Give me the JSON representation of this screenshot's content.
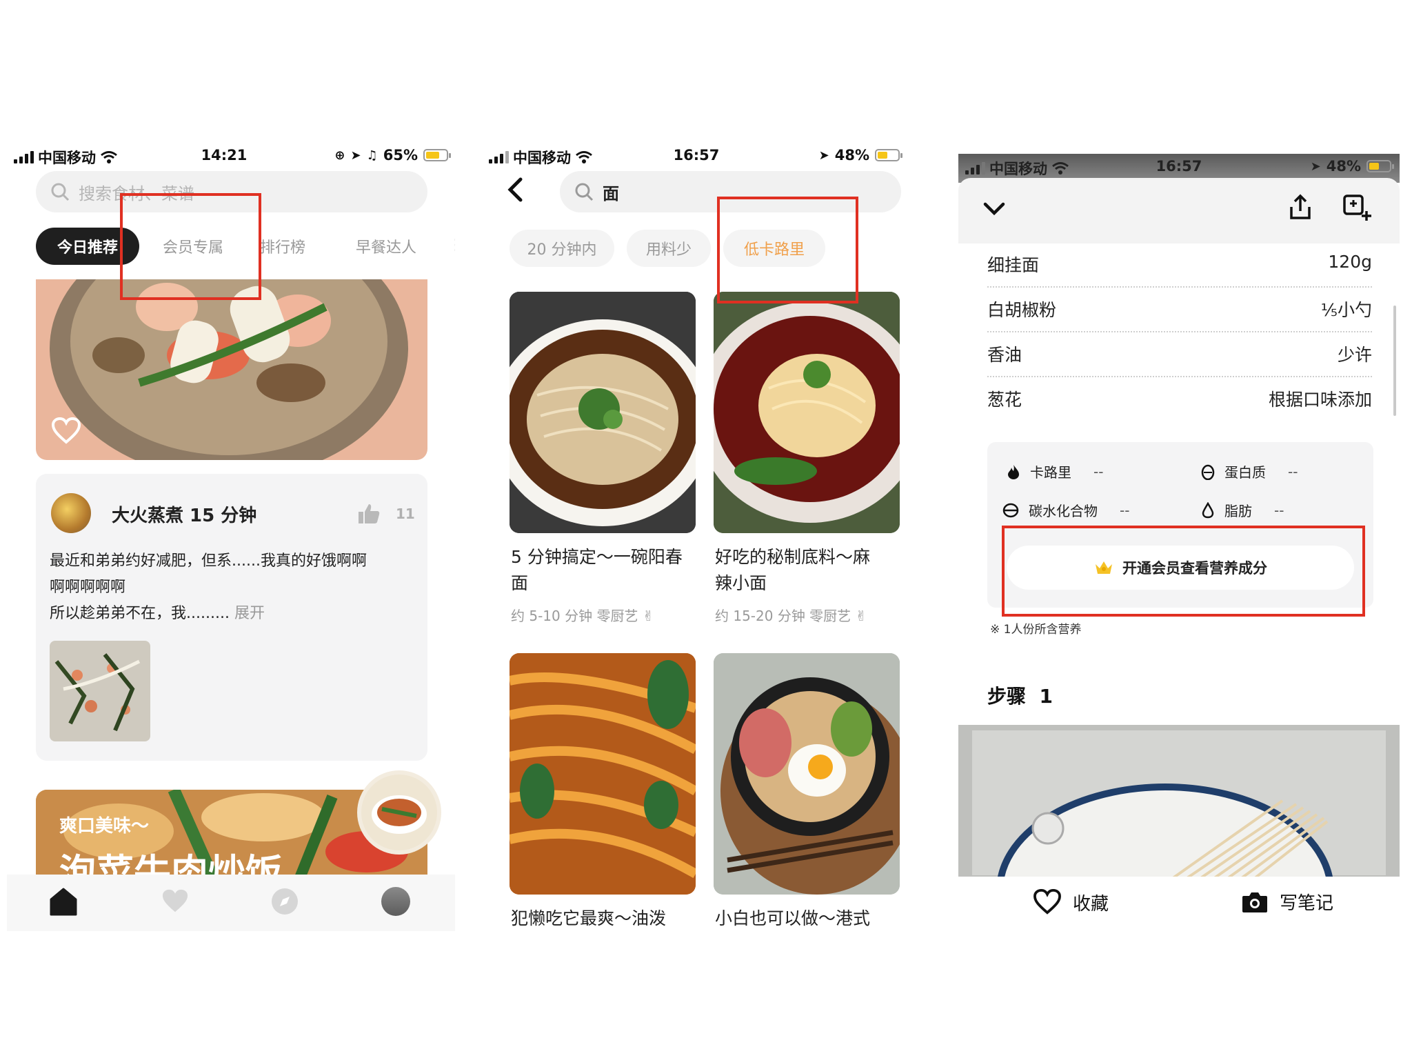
{
  "screen1": {
    "status": {
      "carrier": "中国移动",
      "time": "14:21",
      "battery": "65%",
      "battery_color": "#f5c518"
    },
    "search": {
      "placeholder": "搜索食材、菜谱"
    },
    "tabs": [
      "今日推荐",
      "会员专属",
      "排行榜",
      "早餐达人"
    ],
    "post": {
      "title": "大火蒸煮 15 分钟",
      "likes": "11",
      "text1": "最近和弟弟约好减肥，但系......我真的好饿啊啊",
      "text2": "啊啊啊啊啊",
      "text3": "所以趁弟弟不在，我......... ",
      "expand": "展开"
    },
    "banner": {
      "subtitle": "爽口美味～",
      "title": "泡菜牛肉炒饭"
    },
    "nav": [
      "home-icon",
      "heart-icon",
      "compass-icon",
      "avatar"
    ]
  },
  "screen2": {
    "status": {
      "carrier": "中国移动",
      "time": "16:57",
      "battery": "48%",
      "battery_color": "#f5c518"
    },
    "search": {
      "value": "面"
    },
    "filters": [
      "20 分钟内",
      "用料少",
      "低卡路里"
    ],
    "accent": "#f0a04b",
    "recipes": [
      {
        "title1": "5 分钟搞定～一碗阳春",
        "title2": "面",
        "meta": "约 5-10 分钟   零厨艺 ✌"
      },
      {
        "title1": "好吃的秘制底料～麻",
        "title2": "辣小面",
        "meta": "约 15-20 分钟   零厨艺 ✌"
      },
      {
        "title1": "犯懒吃它最爽～油泼",
        "title2": "",
        "meta": ""
      },
      {
        "title1": "小白也可以做～港式",
        "title2": "",
        "meta": ""
      }
    ]
  },
  "screen3": {
    "status": {
      "carrier": "中国移动",
      "time": "16:57",
      "battery": "48%"
    },
    "ingredients": [
      {
        "name": "细挂面",
        "amount": "120g"
      },
      {
        "name": "白胡椒粉",
        "amount": "⅕小勺"
      },
      {
        "name": "香油",
        "amount": "少许"
      },
      {
        "name": "葱花",
        "amount": "根据口味添加"
      }
    ],
    "nutrition": [
      {
        "label": "卡路里",
        "value": "--",
        "icon": "flame-icon"
      },
      {
        "label": "蛋白质",
        "value": "--",
        "icon": "egg-icon"
      },
      {
        "label": "碳水化合物",
        "value": "--",
        "icon": "carb-icon"
      },
      {
        "label": "脂肪",
        "value": "--",
        "icon": "drop-icon"
      }
    ],
    "member_button": "开通会员查看营养成分",
    "footnote": "※ 1人份所含营养",
    "step_title": "步骤  1",
    "bottom": {
      "collect": "收藏",
      "note": "写笔记"
    }
  },
  "highlight_color": "#e03022"
}
